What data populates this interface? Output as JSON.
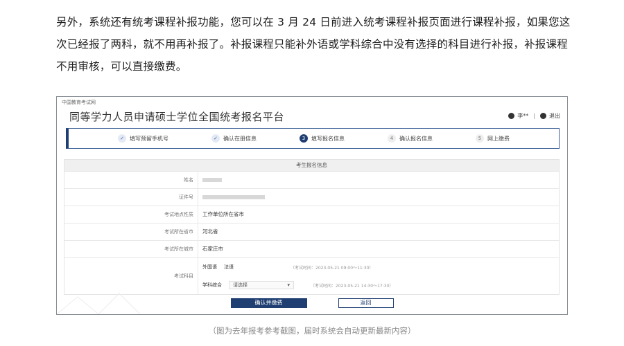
{
  "intro_text": "另外，系统还有统考课程补报功能，您可以在 3 月 24 日前进入统考课程补报页面进行课程补报，如果您这次已经报了两科，就不用再补报了。补报课程只能补外语或学科综合中没有选择的科目进行补报，补报课程不用审核，可以直接缴费。",
  "screenshot": {
    "site_name": "中国教育考试网",
    "platform_title": "同等学力人员申请硕士学位全国统考报名平台",
    "user": {
      "name": "李**",
      "logout": "退出"
    },
    "steps": [
      {
        "marker": "✓",
        "label": "填写预留手机号",
        "state": "done"
      },
      {
        "marker": "✓",
        "label": "确认在册信息",
        "state": "done"
      },
      {
        "marker": "3",
        "label": "填写报名信息",
        "state": "active"
      },
      {
        "marker": "4",
        "label": "确认报名信息",
        "state": "pending"
      },
      {
        "marker": "5",
        "label": "网上缴费",
        "state": "pending"
      }
    ],
    "form_title": "考生报名信息",
    "fields": {
      "name_label": "姓名",
      "id_label": "证件号",
      "exam_loc_type_label": "考试地点性质",
      "exam_loc_type_value": "工作单位所在省市",
      "province_label": "考试所在省市",
      "province_value": "河北省",
      "city_label": "考试所在城市",
      "city_value": "石家庄市",
      "subjects_label": "考试科目"
    },
    "subjects": [
      {
        "name": "外国语",
        "value": "法语",
        "time": "（考试时间：2023-05-21 09:00～11:30）"
      },
      {
        "name": "学科综合",
        "value": "请选择",
        "time": "（考试时间：2023-05-21 14:30～17:30）"
      }
    ],
    "confirm_button": "确认并缴费",
    "back_button": "返回"
  },
  "caption": "（图为去年报考参考截图，届时系统会自动更新最新内容）"
}
